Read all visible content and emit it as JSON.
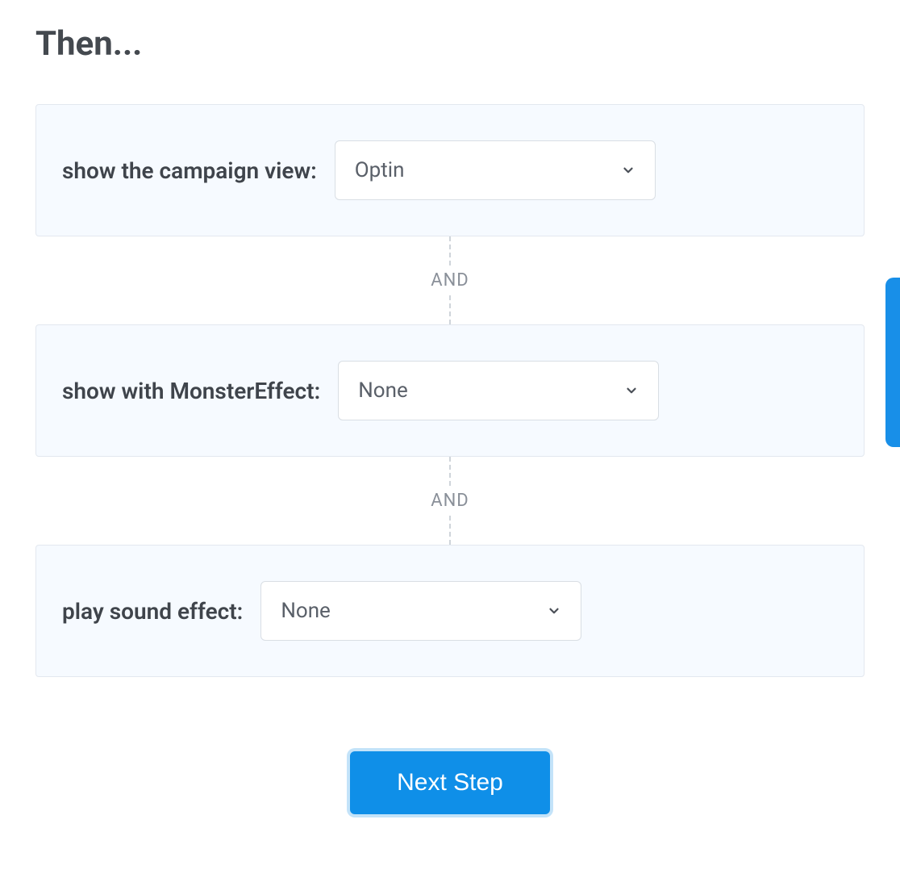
{
  "heading": "Then...",
  "connector_label": "AND",
  "actions": [
    {
      "label": "show the campaign view:",
      "value": "Optin"
    },
    {
      "label": "show with MonsterEffect:",
      "value": "None"
    },
    {
      "label": "play sound effect:",
      "value": "None"
    }
  ],
  "next_button": "Next Step"
}
